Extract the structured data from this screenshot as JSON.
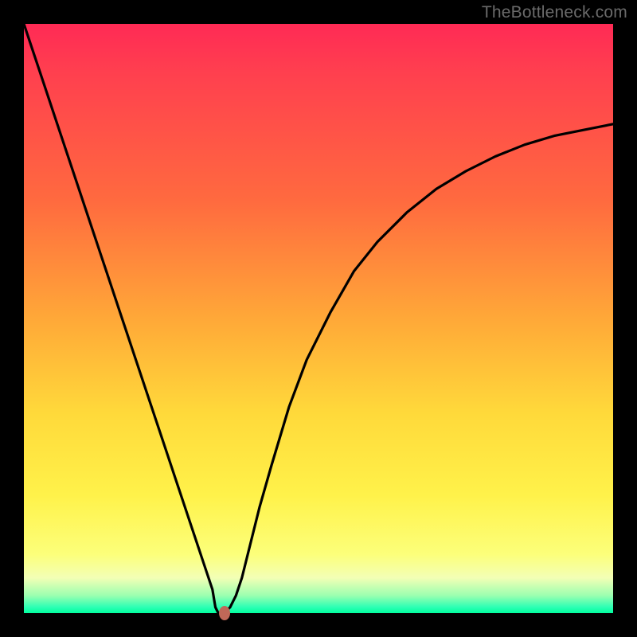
{
  "watermark": "TheBottleneck.com",
  "colors": {
    "frame": "#000000",
    "curve": "#000000",
    "marker": "#c06858",
    "gradient_top": "#ff2a55",
    "gradient_bottom": "#00ff9d"
  },
  "chart_data": {
    "type": "line",
    "title": "",
    "xlabel": "",
    "ylabel": "",
    "xlim": [
      0,
      100
    ],
    "ylim": [
      0,
      100
    ],
    "grid": false,
    "legend": false,
    "series": [
      {
        "name": "bottleneck-curve",
        "x": [
          0,
          2,
          4,
          6,
          8,
          10,
          12,
          14,
          16,
          18,
          20,
          22,
          24,
          26,
          28,
          30,
          32,
          32.5,
          33,
          34,
          35,
          36,
          37,
          38,
          40,
          42,
          45,
          48,
          52,
          56,
          60,
          65,
          70,
          75,
          80,
          85,
          90,
          95,
          100
        ],
        "values": [
          100,
          94,
          88,
          82,
          76,
          70,
          64,
          58,
          52,
          46,
          40,
          34,
          28,
          22,
          16,
          10,
          4,
          1,
          0,
          0,
          1,
          3,
          6,
          10,
          18,
          25,
          35,
          43,
          51,
          58,
          63,
          68,
          72,
          75,
          77.5,
          79.5,
          81,
          82,
          83
        ]
      }
    ],
    "marker": {
      "x": 34,
      "y": 0
    },
    "annotations": []
  }
}
